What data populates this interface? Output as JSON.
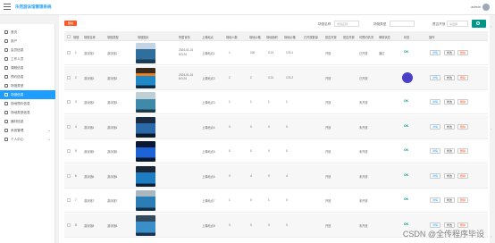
{
  "app": {
    "title": "乐然游泳馆管理系统",
    "user": "admin"
  },
  "sidebar": {
    "items": [
      {
        "label": "首页",
        "icon": "home-icon",
        "active": false
      },
      {
        "label": "用户",
        "icon": "user-icon",
        "active": false
      },
      {
        "label": "会员信息",
        "icon": "grid-icon",
        "active": false
      },
      {
        "label": "工作人员",
        "icon": "people-icon",
        "active": false
      },
      {
        "label": "课程信息",
        "icon": "grid-icon",
        "active": false
      },
      {
        "label": "预约信息",
        "icon": "grid-icon",
        "active": false
      },
      {
        "label": "场馆类型",
        "icon": "grid-icon",
        "active": false
      },
      {
        "label": "场馆信息",
        "icon": "grid-icon",
        "active": true
      },
      {
        "label": "场地预约信息",
        "icon": "grid-icon",
        "active": false
      },
      {
        "label": "场地类型信息",
        "icon": "grid-icon",
        "active": false
      },
      {
        "label": "器材信息",
        "icon": "grid-icon",
        "active": false
      },
      {
        "label": "系统管理",
        "icon": "grid-icon",
        "active": false
      },
      {
        "label": "个人中心",
        "icon": "monitor-icon",
        "active": false
      }
    ]
  },
  "toolbar": {
    "delete_all": "删除"
  },
  "filters": [
    {
      "label": "场馆名称",
      "placeholder": "场馆名称"
    },
    {
      "label": "场馆类型",
      "placeholder": ""
    },
    {
      "label": "是否开放",
      "placeholder": "请选择"
    }
  ],
  "table": {
    "headers": [
      "场馆",
      "场馆名称",
      "场馆类型",
      "场馆图片",
      "所属省份",
      "上课地点",
      "场地人数",
      "场地价格",
      "场地面积",
      "场地价格",
      "已开放数量",
      "是否开放",
      "是否开放",
      "可预约情况",
      "审核状态",
      "状态",
      "操作"
    ],
    "rows": [
      {
        "no": "1",
        "name": "游泳馆1",
        "type": "游泳馆1",
        "date": "2024-01-01\n8:0:24",
        "place": "上课地点1",
        "n1": "1",
        "n2": "100",
        "n3": "0.21",
        "n4": "174.1",
        "open": "开放",
        "avail": "已开放",
        "audit": "通过",
        "status": "OK"
      },
      {
        "no": "2",
        "name": "游泳馆2",
        "type": "游泳馆2",
        "date": "2024-01-01\n8:0:24",
        "place": "上课地点2",
        "n1": "2",
        "n2": "2",
        "n3": "0.21",
        "n4": "174.2",
        "open": "开放",
        "avail": "已开放",
        "audit": "",
        "status": ""
      },
      {
        "no": "3",
        "name": "游泳馆3",
        "type": "游泳馆3",
        "date": "",
        "place": "上课地点3",
        "n1": "1",
        "n2": "1",
        "n3": "1",
        "n4": "1",
        "open": "开放",
        "avail": "未开放",
        "audit": "",
        "status": "OK"
      },
      {
        "no": "4",
        "name": "游泳馆4",
        "type": "游泳馆4",
        "date": "",
        "place": "上课地点4",
        "n1": "0",
        "n2": "0",
        "n3": "0",
        "n4": "0",
        "open": "开放",
        "avail": "未开放",
        "audit": "",
        "status": "OK"
      },
      {
        "no": "5",
        "name": "游泳馆5",
        "type": "游泳馆5",
        "date": "",
        "place": "上课地点5",
        "n1": "0",
        "n2": "0",
        "n3": "0",
        "n4": "0",
        "open": "开放",
        "avail": "未开放",
        "audit": "",
        "status": "OK"
      },
      {
        "no": "6",
        "name": "游泳馆6",
        "type": "游泳馆6",
        "date": "",
        "place": "上课地点6",
        "n1": "0",
        "n2": "4",
        "n3": "0",
        "n4": "4",
        "open": "开放",
        "avail": "未开放",
        "audit": "",
        "status": "OK"
      },
      {
        "no": "7",
        "name": "游泳馆7",
        "type": "游泳馆7",
        "date": "",
        "place": "上课地点7",
        "n1": "1",
        "n2": "0",
        "n3": "1",
        "n4": "0",
        "open": "开放",
        "avail": "未开放",
        "audit": "",
        "status": "OK"
      },
      {
        "no": "8",
        "name": "游泳馆8",
        "type": "游泳馆8",
        "date": "",
        "place": "上课地点8",
        "n1": "0",
        "n2": "0",
        "n3": "0",
        "n4": "0",
        "open": "开放",
        "avail": "未开放",
        "audit": "",
        "status": "OK"
      }
    ],
    "ops": {
      "view": "详情",
      "edit": "修改",
      "del": "删除"
    }
  },
  "colors": {
    "accent": "#1e9fff",
    "danger": "#ff5722",
    "success": "#009688"
  },
  "watermark": "CSDN @全传程序毕设"
}
